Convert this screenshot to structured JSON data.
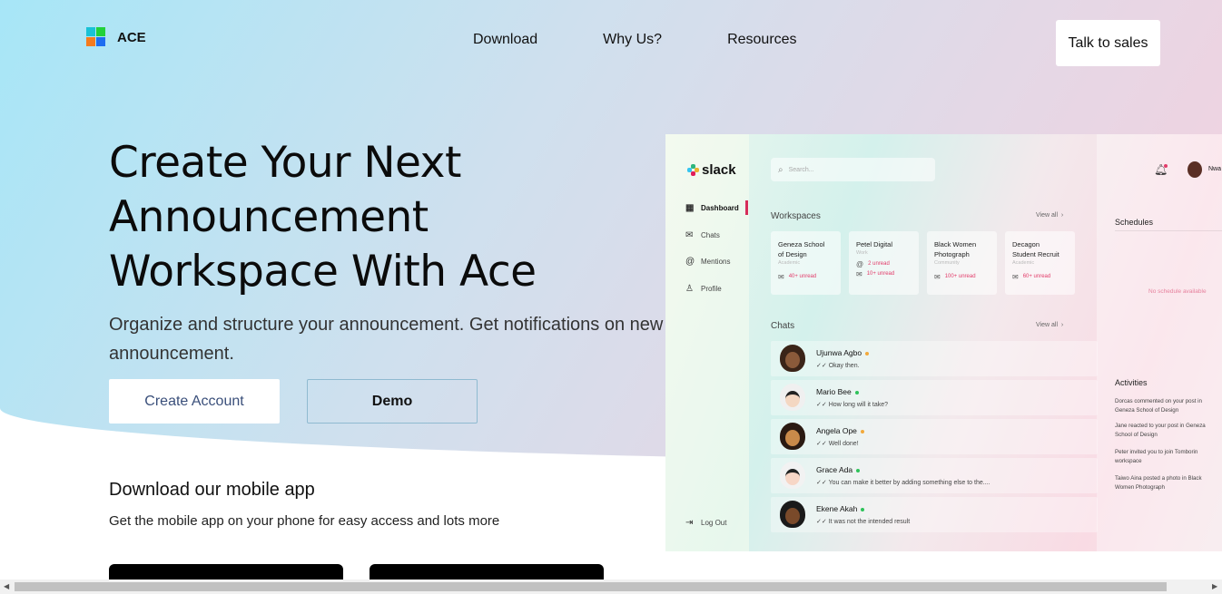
{
  "brand": {
    "name": "ACE"
  },
  "nav": {
    "items": [
      "Download",
      "Why Us?",
      "Resources"
    ],
    "cta": "Talk to sales"
  },
  "hero": {
    "title_lines": [
      "Create Your Next",
      "Announcement",
      "Workspace With Ace"
    ],
    "subtitle": "Organize and structure your announcement. Get notifications on new announcement.",
    "create_label": "Create Account",
    "demo_label": "Demo"
  },
  "download": {
    "title": "Download our mobile app",
    "subtitle": "Get the mobile app on your phone for easy access and lots more"
  },
  "mockup": {
    "logo": "slack",
    "search_placeholder": "Search...",
    "sidebar": [
      "Dashboard",
      "Chats",
      "Mentions",
      "Profile"
    ],
    "logout": "Log Out",
    "workspaces_label": "Workspaces",
    "view_all": "View all",
    "workspaces": [
      {
        "name_lines": [
          "Geneza School",
          "of Design"
        ],
        "kind": "Academic",
        "unread1": "",
        "unread2": "40+ unread"
      },
      {
        "name_lines": [
          "Petel Digital",
          ""
        ],
        "kind": "Work",
        "unread1": "2 unread",
        "unread2": "10+ unread"
      },
      {
        "name_lines": [
          "Black Women",
          "Photograph"
        ],
        "kind": "Community",
        "unread1": "",
        "unread2": "100+ unread"
      },
      {
        "name_lines": [
          "Decagon",
          "Student Recruit"
        ],
        "kind": "Academic",
        "unread1": "",
        "unread2": "60+ unread"
      }
    ],
    "chats_label": "Chats",
    "chats": [
      {
        "name": "Ujunwa Agbo",
        "msg": "Okay then.",
        "status": "#f2a93b"
      },
      {
        "name": "Mario Bee",
        "msg": "How long will it take?",
        "status": "#2ec25a"
      },
      {
        "name": "Angela Ope",
        "msg": "Well done!",
        "status": "#f2a93b"
      },
      {
        "name": "Grace Ada",
        "msg": "You can make it better by adding something else to the....",
        "status": "#2ec25a"
      },
      {
        "name": "Ekene Akah",
        "msg": "It was not the intended result",
        "status": "#2ec25a"
      }
    ],
    "user_short": "Nwa",
    "schedules_label": "Schedules",
    "no_schedule": "No schedule available",
    "activities_label": "Activities",
    "activities": [
      "Dorcas commented on your post in Geneza School of Design",
      "Jane reacted to your post in Geneza School of Design",
      "Peter invited you to join Tomborin workspace",
      "Taiwo Aina posted a photo in Black Women Photograph"
    ]
  },
  "colors": {
    "accent_pink": "#e23c6a",
    "button_text_blue": "#3a4f7a"
  }
}
